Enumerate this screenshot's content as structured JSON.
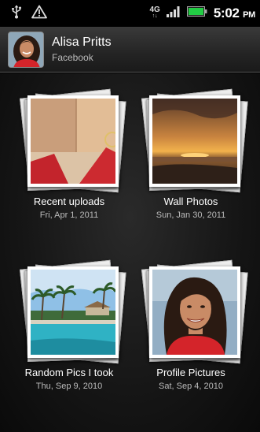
{
  "status_bar": {
    "network": "4G",
    "time": "5:02",
    "ampm": "PM",
    "icons": [
      "usb-icon",
      "warning-icon",
      "signal-icon",
      "battery-icon"
    ]
  },
  "header": {
    "name": "Alisa Pritts",
    "source": "Facebook"
  },
  "albums": [
    {
      "title": "Recent uploads",
      "date": "Fri, Apr 1, 2011"
    },
    {
      "title": "Wall Photos",
      "date": "Sun, Jan 30, 2011"
    },
    {
      "title": "Random Pics I took",
      "date": "Thu, Sep 9, 2010"
    },
    {
      "title": "Profile Pictures",
      "date": "Sat, Sep 4, 2010"
    }
  ],
  "colors": {
    "battery": "#22cc44",
    "background": "#000000",
    "accent_red": "#d4242a"
  }
}
